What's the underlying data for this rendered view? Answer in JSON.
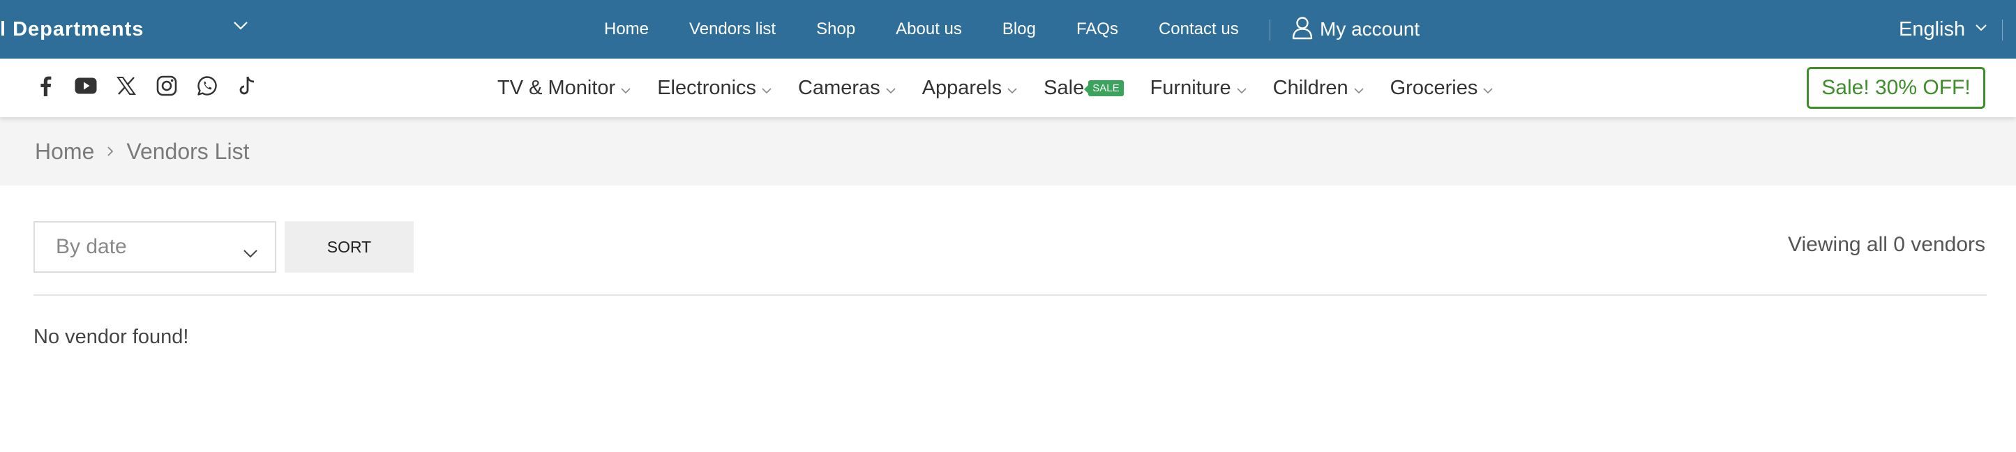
{
  "topbar": {
    "departments_label": "l Departments",
    "links": [
      "Home",
      "Vendors list",
      "Shop",
      "About us",
      "Blog",
      "FAQs",
      "Contact us"
    ],
    "account_label": "My account",
    "language_label": "English",
    "background_color": "#2f6e98"
  },
  "social": [
    "facebook-icon",
    "youtube-icon",
    "x-twitter-icon",
    "instagram-icon",
    "whatsapp-icon",
    "tiktok-icon"
  ],
  "nav": {
    "categories": [
      {
        "label": "TV & Monitor",
        "has_dropdown": true
      },
      {
        "label": "Electronics",
        "has_dropdown": true
      },
      {
        "label": "Cameras",
        "has_dropdown": true
      },
      {
        "label": "Apparels",
        "has_dropdown": true
      },
      {
        "label": "Sale",
        "badge": "SALE",
        "has_dropdown": false
      },
      {
        "label": "Furniture",
        "has_dropdown": true
      },
      {
        "label": "Children",
        "has_dropdown": true
      },
      {
        "label": "Groceries",
        "has_dropdown": true
      }
    ],
    "promo_label": "Sale! 30% OFF!",
    "promo_color": "#3e8e2a",
    "badge_color": "#3aa35c"
  },
  "breadcrumb": {
    "home": "Home",
    "current": "Vendors List"
  },
  "controls": {
    "sort_selected": "By date",
    "sort_button": "SORT",
    "result_count": "Viewing all 0 vendors"
  },
  "content": {
    "empty_message": "No vendor found!"
  }
}
